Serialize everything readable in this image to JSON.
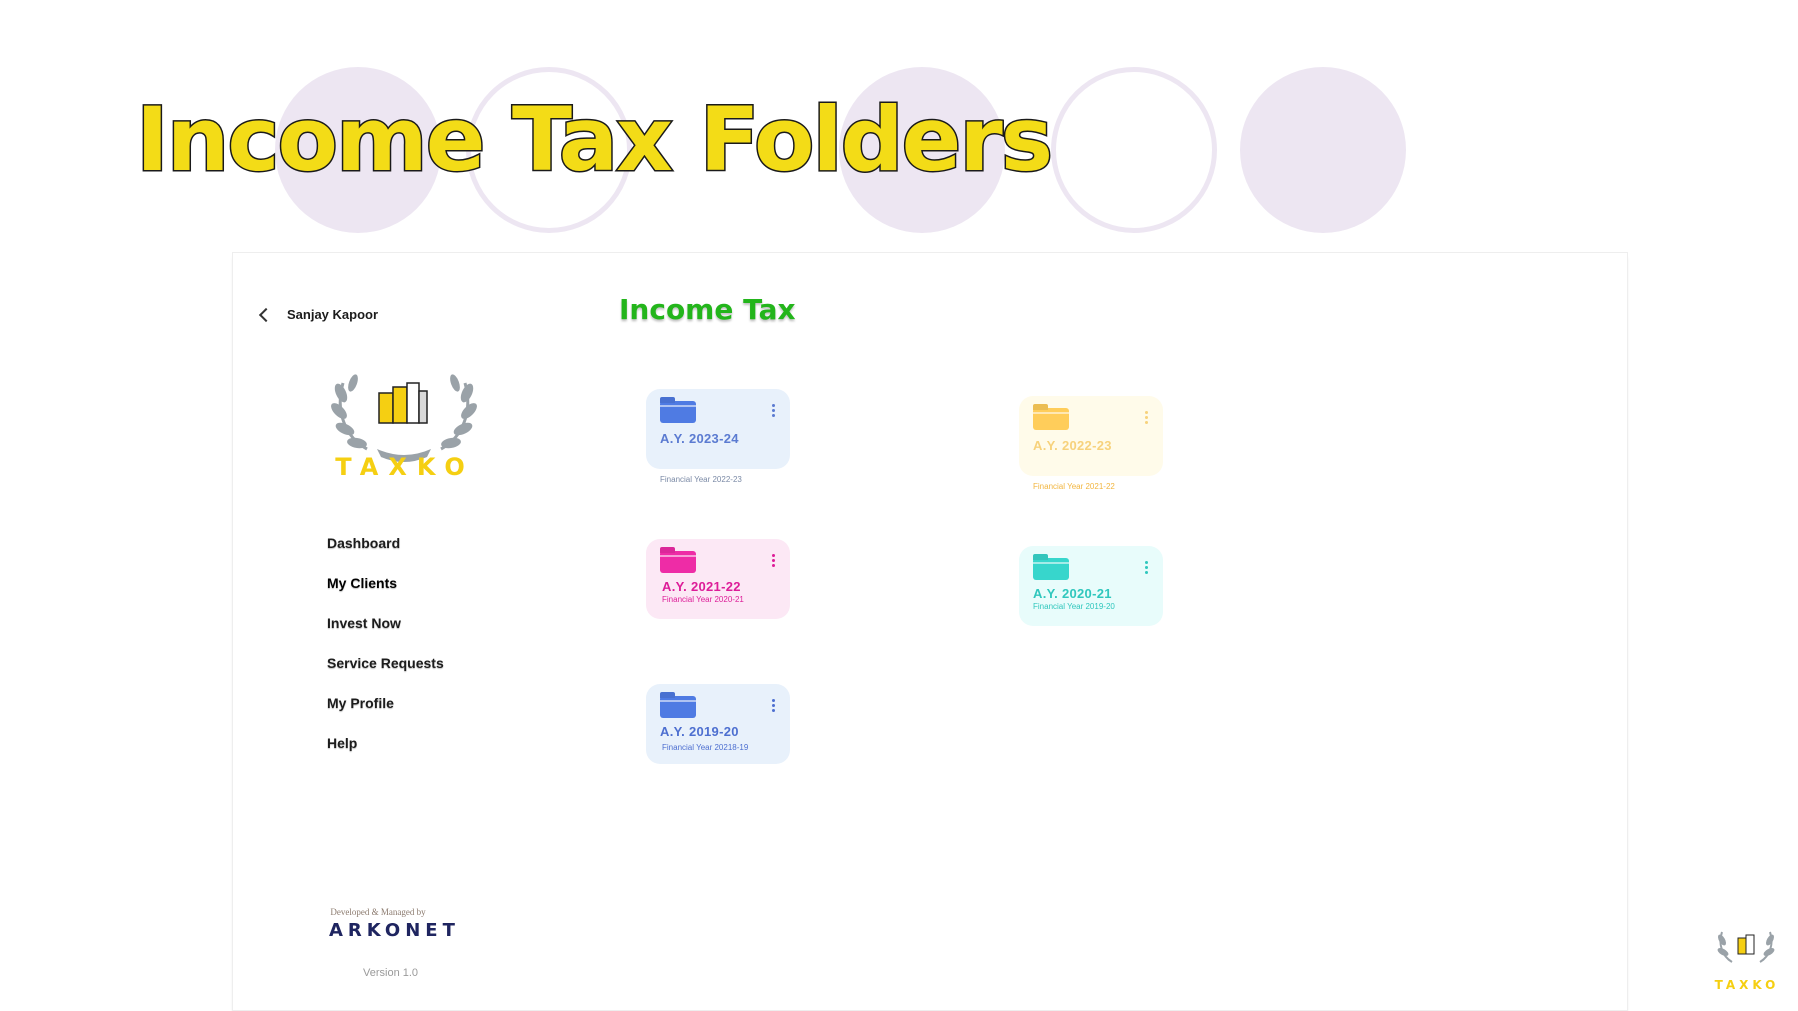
{
  "slide": {
    "title": "Income Tax Folders"
  },
  "app": {
    "back": {
      "name": "Sanjay Kapoor"
    },
    "brand": {
      "text": "TAXKO"
    },
    "nav": {
      "items": [
        {
          "label": "Dashboard"
        },
        {
          "label": "My Clients"
        },
        {
          "label": "Invest Now"
        },
        {
          "label": "Service Requests"
        },
        {
          "label": "My Profile"
        },
        {
          "label": "Help"
        }
      ]
    },
    "footer": {
      "developed_by": "Developed & Managed by",
      "company": "ARKONET",
      "version": "Version 1.0"
    }
  },
  "main": {
    "title": "Income Tax",
    "folders": [
      {
        "ay": "A.Y. 2023-24",
        "fy": "Financial Year 2022-23",
        "icon": "folder-icon",
        "color": "#4f7be3",
        "text_color": "#5b7bd1",
        "sub_color": "#7b8aa6",
        "bg": "#e8f1fb"
      },
      {
        "ay": "A.Y. 2022-23",
        "fy": "Financial Year 2021-22",
        "icon": "folder-icon",
        "color": "#ffcd5a",
        "text_color": "#f7d27c",
        "sub_color": "#f2b640",
        "bg": "#fffbea"
      },
      {
        "ay": "A.Y. 2021-22",
        "fy": "Financial Year 2020-21",
        "icon": "folder-icon",
        "color": "#ee2ca6",
        "text_color": "#dd1c98",
        "sub_color": "#dd1c98",
        "bg": "#fce8f5"
      },
      {
        "ay": "A.Y. 2020-21",
        "fy": "Financial Year 2019-20",
        "icon": "folder-icon",
        "color": "#37d6cc",
        "text_color": "#2fc7bd",
        "sub_color": "#2fc7bd",
        "bg": "#e8fcfb"
      },
      {
        "ay": "A.Y. 2019-20",
        "fy": "Financial Year 20218-19",
        "icon": "folder-icon",
        "color": "#4f7be3",
        "text_color": "#4d6fd0",
        "sub_color": "#4d6fd0",
        "bg": "#e8f1fb"
      }
    ]
  },
  "corner_logo": {
    "text": "TAXKO"
  }
}
